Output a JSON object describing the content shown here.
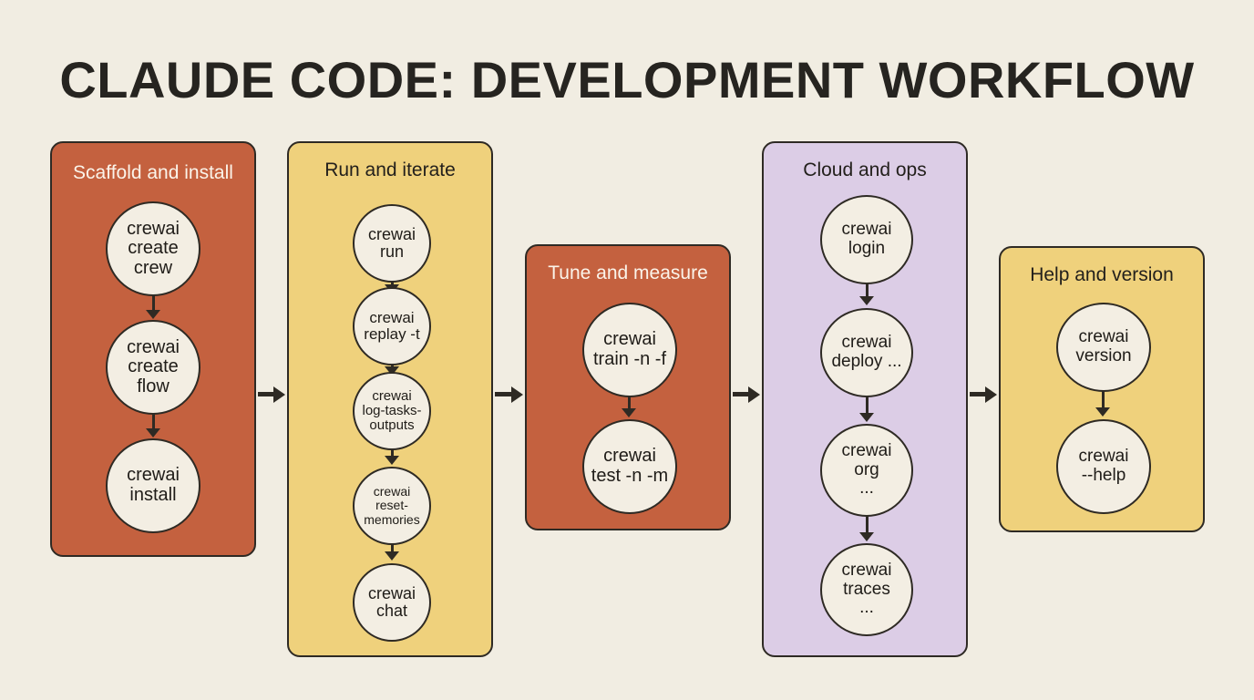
{
  "diagram": {
    "title": "CLAUDE CODE: DEVELOPMENT WORKFLOW",
    "stages": [
      {
        "title": "Scaffold and install",
        "color": "#c4613f",
        "commands": [
          "crewai\ncreate\ncrew",
          "crewai\ncreate\nflow",
          "crewai\ninstall"
        ]
      },
      {
        "title": "Run and iterate",
        "color": "#efd17c",
        "commands": [
          "crewai\nrun",
          "crewai\nreplay -t",
          "crewai\nlog-tasks-\noutputs",
          "crewai\nreset-\nmemories",
          "crewai\nchat"
        ]
      },
      {
        "title": "Tune and measure",
        "color": "#c4613f",
        "commands": [
          "crewai\ntrain -n -f",
          "crewai\ntest -n -m"
        ]
      },
      {
        "title": "Cloud and ops",
        "color": "#dccde6",
        "commands": [
          "crewai\nlogin",
          "crewai\ndeploy ...",
          "crewai\norg\n...",
          "crewai\ntraces\n..."
        ]
      },
      {
        "title": "Help and version",
        "color": "#efd17c",
        "commands": [
          "crewai\nversion",
          "crewai\n--help"
        ]
      }
    ]
  }
}
